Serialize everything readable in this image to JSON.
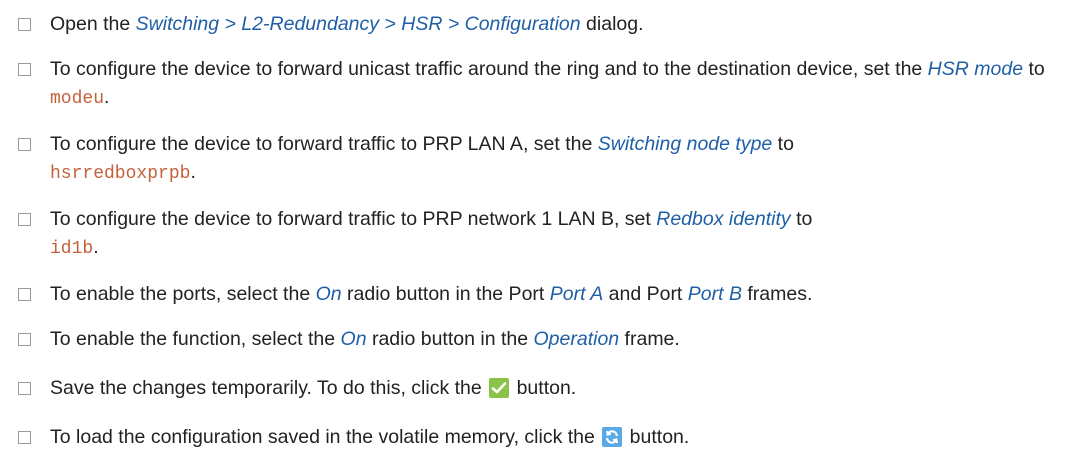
{
  "steps": [
    {
      "pre": "Open the ",
      "path": "Switching > L2-Redundancy > HSR > Configuration",
      "post": " dialog."
    },
    {
      "pre": "To configure the device to forward unicast traffic around the ring and to the destination device, set the ",
      "field": "HSR mode",
      "mid": " to ",
      "value": "modeu",
      "post": "."
    },
    {
      "pre": "To configure the device to forward traffic to PRP LAN A, set the ",
      "field": "Switching node type",
      "mid": " to ",
      "value": "hsrredboxprpb",
      "post": "."
    },
    {
      "pre": "To configure the device to forward traffic to PRP network 1 LAN B, set ",
      "field": "Redbox identity",
      "mid": " to ",
      "value": "id1b",
      "post": "."
    },
    {
      "pre": "To enable the ports, select the ",
      "option": "On",
      "mid1": " radio button in the Port ",
      "portA": "Port A",
      "mid2": " and Port ",
      "portB": "Port B",
      "post": " frames."
    },
    {
      "pre": "To enable the function, select the ",
      "option": "On",
      "mid": " radio button in the ",
      "frame": "Operation",
      "post": " frame."
    },
    {
      "pre": "Save the changes temporarily. To do this, click the ",
      "icon": "checkmark-icon",
      "post": " button."
    },
    {
      "pre": "To load the configuration saved in the volatile memory, click the ",
      "icon": "refresh-icon",
      "post": " button."
    }
  ],
  "colors": {
    "ui_reference": "#1f5fa6",
    "code_value": "#c4613a",
    "checkmark_button": "#8bc34a",
    "refresh_button": "#5aa9e6"
  }
}
